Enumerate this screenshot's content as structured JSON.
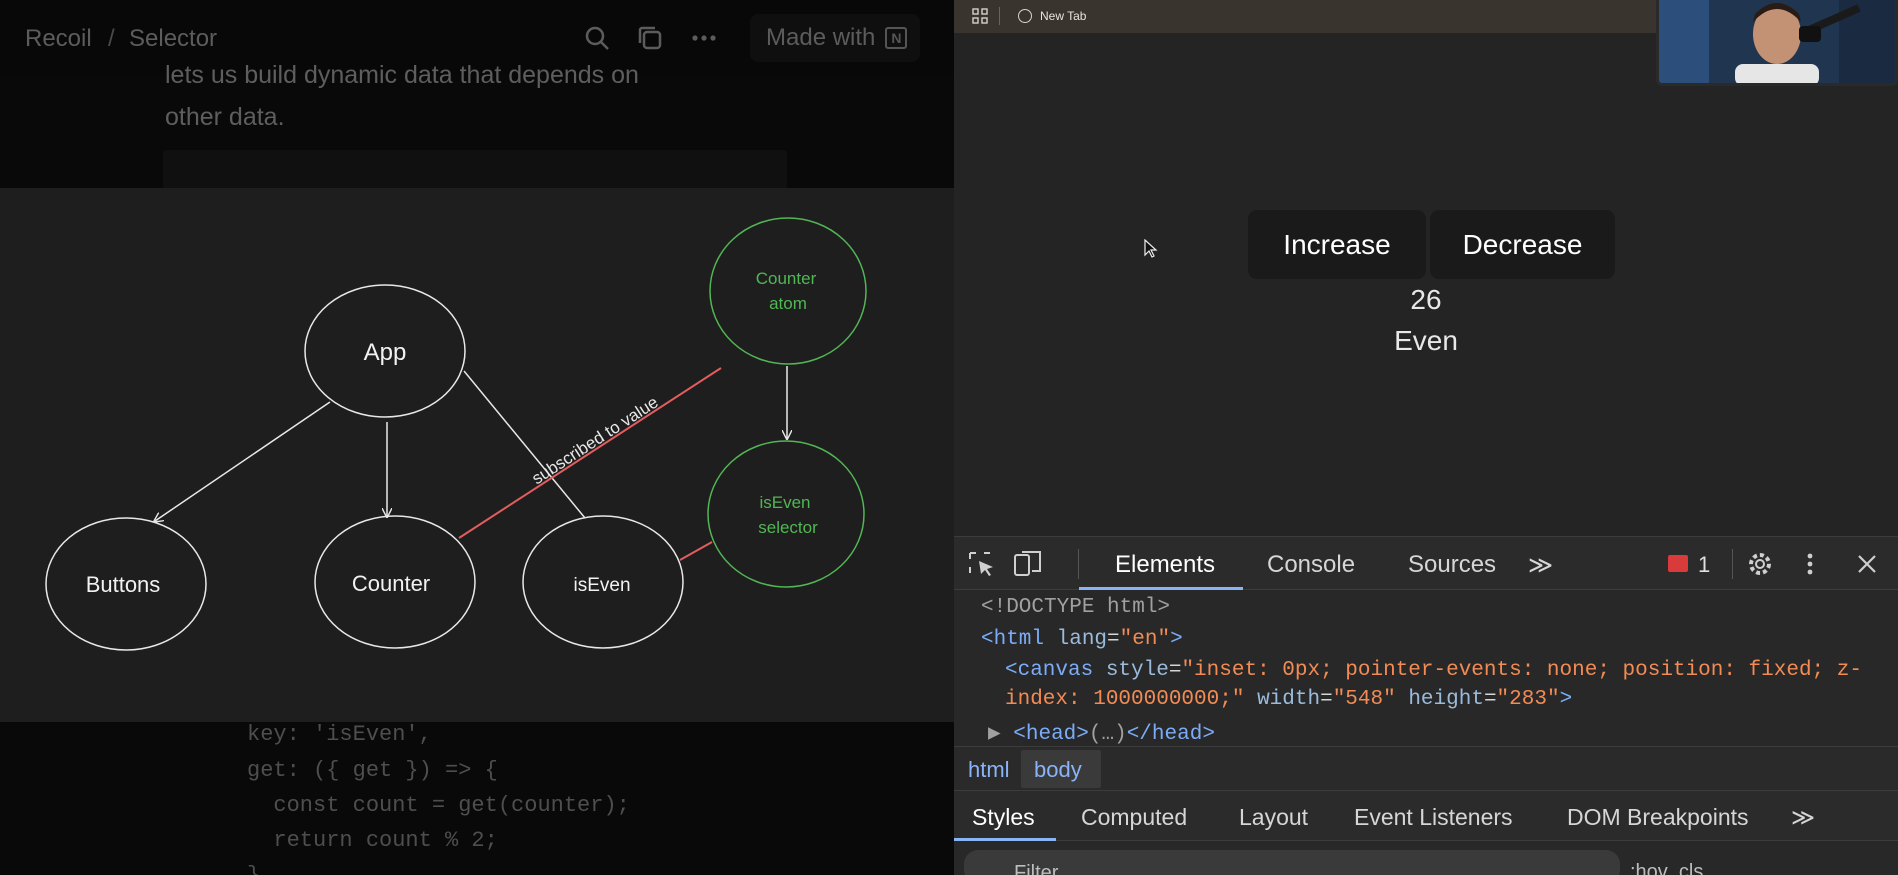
{
  "notion": {
    "breadcrumb": [
      "Recoil",
      "Selector"
    ],
    "made_with_label": "Made with",
    "intro_lines": [
      "lets us build dynamic data that depends on",
      "other data."
    ]
  },
  "diagram": {
    "nodes": {
      "app": "App",
      "buttons": "Buttons",
      "counter": "Counter",
      "is_even": "isEven",
      "counter_atom": [
        "Counter",
        "atom"
      ],
      "is_even_selector": [
        "isEven",
        "selector"
      ]
    },
    "edge_label": "subscribed to value",
    "colors": {
      "node_stroke": "#e8e8e8",
      "green": "#52b654",
      "red_edge": "#e35d5d",
      "background": "#1e1e1e"
    }
  },
  "code": {
    "lines": [
      "key: 'isEven',",
      "get: ({ get }) => {",
      "  const count = get(counter);",
      "  return count % 2;",
      "}"
    ]
  },
  "browser": {
    "bookmark_label": "New Tab"
  },
  "app": {
    "increase_label": "Increase",
    "decrease_label": "Decrease",
    "count": "26",
    "parity": "Even"
  },
  "devtools": {
    "tabs": [
      "Elements",
      "Console",
      "Sources"
    ],
    "more_tabs": "≫",
    "error_count": "1",
    "dom": {
      "doctype": "<!DOCTYPE html>",
      "html_open": "<html",
      "lang_attr": "lang",
      "lang_val": "\"en\"",
      "canvas_tag": "<canvas",
      "style_attr": "style",
      "style_val_1": "\"inset: 0px; pointer-events: none; position: fixed; z-",
      "style_val_2": "index: 1000000000;\"",
      "width_attr": "width",
      "width_val": "\"548\"",
      "height_attr": "height",
      "height_val": "\"283\"",
      "head_open": "<head>",
      "head_close": "</head>"
    },
    "breadcrumb": [
      "html",
      "body"
    ],
    "style_tabs": [
      "Styles",
      "Computed",
      "Layout",
      "Event Listeners",
      "DOM Breakpoints"
    ],
    "filter_placeholder": "Filter",
    "filter_right": ":hov .cls"
  }
}
